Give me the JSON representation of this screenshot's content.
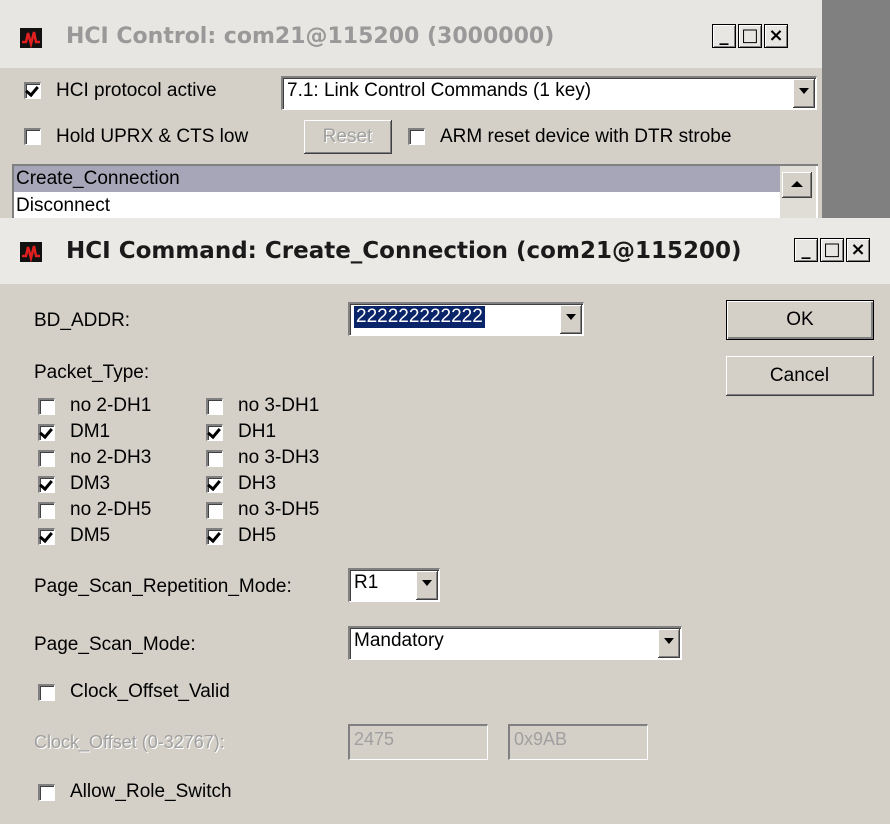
{
  "control_window": {
    "title": "HCI Control: com21@115200 (3000000)",
    "hci_protocol_active": {
      "label": "HCI protocol active",
      "checked": true
    },
    "command_group": "7.1: Link Control Commands (1 key)",
    "hold_uprx": {
      "label": "Hold UPRX & CTS low",
      "checked": false
    },
    "reset_label": "Reset",
    "arm_reset": {
      "label": "ARM reset device with DTR strobe",
      "checked": false
    },
    "commands": [
      "Create_Connection",
      "Disconnect"
    ]
  },
  "dialog": {
    "title": "HCI Command: Create_Connection (com21@115200)",
    "bd_addr_label": "BD_ADDR:",
    "bd_addr_value": "222222222222",
    "ok_label": "OK",
    "cancel_label": "Cancel",
    "packet_type_label": "Packet_Type:",
    "packet_types_left": [
      {
        "label": "no 2-DH1",
        "checked": false
      },
      {
        "label": "DM1",
        "checked": true
      },
      {
        "label": "no 2-DH3",
        "checked": false
      },
      {
        "label": "DM3",
        "checked": true
      },
      {
        "label": "no 2-DH5",
        "checked": false
      },
      {
        "label": "DM5",
        "checked": true
      }
    ],
    "packet_types_right": [
      {
        "label": "no 3-DH1",
        "checked": false
      },
      {
        "label": "DH1",
        "checked": true
      },
      {
        "label": "no 3-DH3",
        "checked": false
      },
      {
        "label": "DH3",
        "checked": true
      },
      {
        "label": "no 3-DH5",
        "checked": false
      },
      {
        "label": "DH5",
        "checked": true
      }
    ],
    "page_scan_rep_label": "Page_Scan_Repetition_Mode:",
    "page_scan_rep_value": "R1",
    "page_scan_mode_label": "Page_Scan_Mode:",
    "page_scan_mode_value": "Mandatory",
    "clock_offset_valid": {
      "label": "Clock_Offset_Valid",
      "checked": false
    },
    "clock_offset_label": "Clock_Offset (0-32767):",
    "clock_offset_dec": "2475",
    "clock_offset_hex": "0x9AB",
    "allow_role_switch": {
      "label": "Allow_Role_Switch",
      "checked": false
    }
  },
  "icons": [
    "app-wave-icon",
    "minimize-icon",
    "maximize-icon",
    "close-icon",
    "scroll-up-icon",
    "dropdown-arrow-icon",
    "checkmark-icon"
  ]
}
